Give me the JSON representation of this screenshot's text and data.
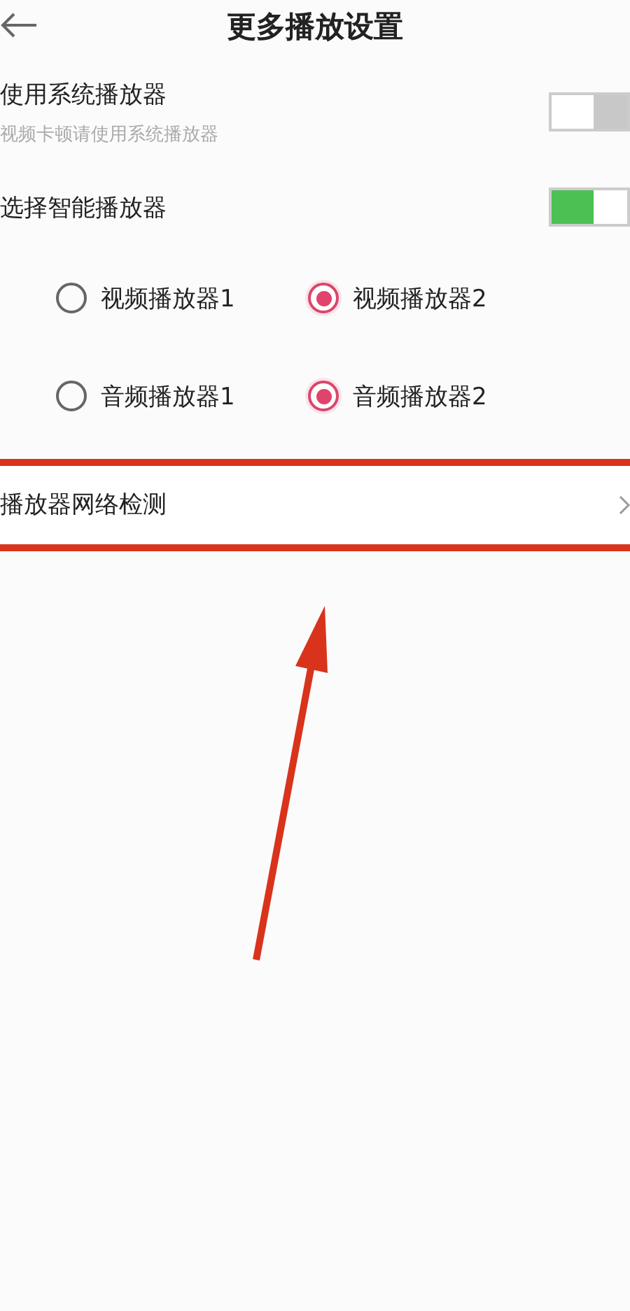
{
  "header": {
    "title": "更多播放设置"
  },
  "switches": [
    {
      "label": "使用系统播放器",
      "hint": "视频卡顿请使用系统播放器",
      "on": false
    },
    {
      "label": "选择智能播放器",
      "on": true
    }
  ],
  "radio_groups": [
    {
      "options": [
        {
          "label": "视频播放器1",
          "selected": false
        },
        {
          "label": "视频播放器2",
          "selected": true
        }
      ]
    },
    {
      "options": [
        {
          "label": "音频播放器1",
          "selected": false
        },
        {
          "label": "音频播放器2",
          "selected": true
        }
      ]
    }
  ],
  "network_row": {
    "label": "播放器网络检测"
  }
}
